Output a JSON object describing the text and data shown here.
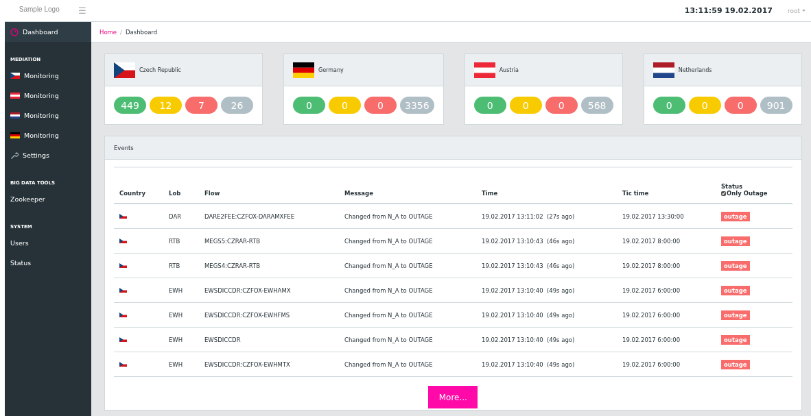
{
  "header": {
    "logo": "Sample Logo",
    "menu_icon": "☰",
    "clock": "13:11:59 19.02.2017",
    "user": "root"
  },
  "sidebar": {
    "items": [
      {
        "kind": "dashboard",
        "label": "Dashboard",
        "selected": true
      },
      {
        "kind": "heading",
        "label": "MEDIATION"
      },
      {
        "kind": "cz",
        "label": "Monitoring",
        "selected": false
      },
      {
        "kind": "at",
        "label": "Monitoring",
        "selected": false
      },
      {
        "kind": "nl",
        "label": "Monitoring",
        "selected": false
      },
      {
        "kind": "de",
        "label": "Monitoring",
        "selected": false
      },
      {
        "kind": "settings",
        "label": "Settings",
        "selected": false
      },
      {
        "kind": "heading",
        "label": "BIG DATA TOOLS"
      },
      {
        "kind": "link",
        "label": "Zookeeper",
        "selected": false
      },
      {
        "kind": "heading",
        "label": "SYSTEM"
      },
      {
        "kind": "link",
        "label": "Users",
        "selected": false
      },
      {
        "kind": "link",
        "label": "Status",
        "selected": false
      }
    ]
  },
  "breadcrumb": [
    {
      "label": "Home",
      "kind": "link"
    },
    {
      "label": "/",
      "kind": "separator"
    },
    {
      "label": "Dashboard",
      "kind": "current"
    }
  ],
  "countries": [
    {
      "name": "Czech Republic",
      "kind": "cz",
      "counts": [
        {
          "kind": "ok",
          "value": "449"
        },
        {
          "kind": "warning",
          "value": "12"
        },
        {
          "kind": "error",
          "value": "7"
        },
        {
          "kind": "other",
          "value": "26"
        }
      ]
    },
    {
      "name": "Germany",
      "kind": "de",
      "counts": [
        {
          "kind": "ok",
          "value": "0"
        },
        {
          "kind": "warning",
          "value": "0"
        },
        {
          "kind": "error",
          "value": "0"
        },
        {
          "kind": "other",
          "value": "3356"
        }
      ]
    },
    {
      "name": "Austria",
      "kind": "at",
      "counts": [
        {
          "kind": "ok",
          "value": "0"
        },
        {
          "kind": "warning",
          "value": "0"
        },
        {
          "kind": "error",
          "value": "0"
        },
        {
          "kind": "other",
          "value": "568"
        }
      ]
    },
    {
      "name": "Netherlands",
      "kind": "nl",
      "counts": [
        {
          "kind": "ok",
          "value": "0"
        },
        {
          "kind": "warning",
          "value": "0"
        },
        {
          "kind": "error",
          "value": "0"
        },
        {
          "kind": "other",
          "value": "901"
        }
      ]
    }
  ],
  "events": {
    "title": "Events",
    "columns": [
      "Country",
      "Lob",
      "Flow",
      "Message",
      "Time",
      "Tic time",
      "Status"
    ],
    "only_outage": {
      "label": "Only Outage",
      "checked": true
    },
    "rows": [
      {
        "kind": "cz",
        "lob": "DAR",
        "flow": "DARE2FEE:CZFOX-DARAMXFEE",
        "message": "Changed from N_A to OUTAGE",
        "time": "19.02.2017 13:11:02  (27s ago)",
        "tic_time": "19.02.2017 13:30:00",
        "status": "outage"
      },
      {
        "kind": "cz",
        "lob": "RTB",
        "flow": "MEGS5:CZRAR-RTB",
        "message": "Changed from N_A to OUTAGE",
        "time": "19.02.2017 13:10:43  (46s ago)",
        "tic_time": "19.02.2017 8:00:00",
        "status": "outage"
      },
      {
        "kind": "cz",
        "lob": "RTB",
        "flow": "MEGS4:CZRAR-RTB",
        "message": "Changed from N_A to OUTAGE",
        "time": "19.02.2017 13:10:43  (46s ago)",
        "tic_time": "19.02.2017 8:00:00",
        "status": "outage"
      },
      {
        "kind": "cz",
        "lob": "EWH",
        "flow": "EWSDICCDR:CZFOX-EWHAMX",
        "message": "Changed from N_A to OUTAGE",
        "time": "19.02.2017 13:10:40  (49s ago)",
        "tic_time": "19.02.2017 6:00:00",
        "status": "outage"
      },
      {
        "kind": "cz",
        "lob": "EWH",
        "flow": "EWSDICCDR:CZFOX-EWHFMS",
        "message": "Changed from N_A to OUTAGE",
        "time": "19.02.2017 13:10:40  (49s ago)",
        "tic_time": "19.02.2017 6:00:00",
        "status": "outage"
      },
      {
        "kind": "cz",
        "lob": "EWH",
        "flow": "EWSDICCDR",
        "message": "Changed from N_A to OUTAGE",
        "time": "19.02.2017 13:10:40  (49s ago)",
        "tic_time": "19.02.2017 6:00:00",
        "status": "outage"
      },
      {
        "kind": "cz",
        "lob": "EWH",
        "flow": "EWSDICCDR:CZFOX-EWHMTX",
        "message": "Changed from N_A to OUTAGE",
        "time": "19.02.2017 13:10:40  (49s ago)",
        "tic_time": "19.02.2017 6:00:00",
        "status": "outage"
      }
    ],
    "more_button": "More..."
  }
}
